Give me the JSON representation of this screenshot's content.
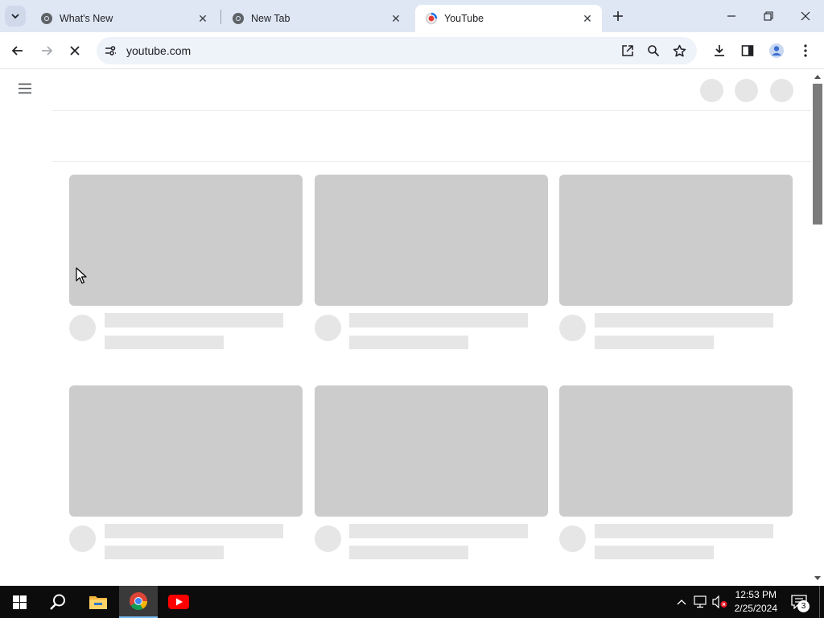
{
  "browser": {
    "tabs": [
      {
        "title": "What's New",
        "active": false,
        "icon": "chrome-icon"
      },
      {
        "title": "New Tab",
        "active": false,
        "icon": "chrome-icon"
      },
      {
        "title": "YouTube",
        "active": true,
        "icon": "youtube-loading-icon"
      }
    ],
    "address": "youtube.com",
    "accent": "#dfe7f5"
  },
  "page": {
    "state": "loading-skeleton",
    "skeleton_color": "#cccccc",
    "skeleton_light_color": "#e6e6e6"
  },
  "taskbar": {
    "time": "12:53 PM",
    "date": "2/25/2024",
    "notification_count": "3",
    "pinned": [
      "windows-start-icon",
      "search-icon",
      "file-explorer-icon",
      "chrome-icon",
      "youtube-icon"
    ]
  }
}
